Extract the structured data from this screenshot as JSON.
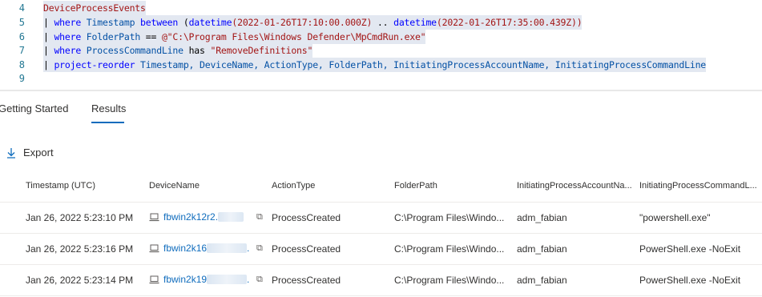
{
  "editor": {
    "lines": [
      {
        "n": "4",
        "parts": [
          {
            "t": "DeviceProcessEvents",
            "c": "kw-table"
          }
        ]
      },
      {
        "n": "5",
        "parts": [
          {
            "t": "| ",
            "c": "op"
          },
          {
            "t": "where",
            "c": "kw"
          },
          {
            "t": " Timestamp ",
            "c": "fld"
          },
          {
            "t": "between",
            "c": "kw"
          },
          {
            "t": " (",
            "c": "op"
          },
          {
            "t": "datetime",
            "c": "kw"
          },
          {
            "t": "(2022-01-26T17:10:00.000Z)",
            "c": "str"
          },
          {
            "t": " .. ",
            "c": "op"
          },
          {
            "t": "datetime",
            "c": "kw"
          },
          {
            "t": "(2022-01-26T17:35:00.439Z))",
            "c": "str"
          }
        ]
      },
      {
        "n": "6",
        "parts": [
          {
            "t": "| ",
            "c": "op"
          },
          {
            "t": "where",
            "c": "kw"
          },
          {
            "t": " FolderPath ",
            "c": "fld"
          },
          {
            "t": "== ",
            "c": "op"
          },
          {
            "t": "@\"C:\\Program Files\\Windows Defender\\MpCmdRun.exe\"",
            "c": "str"
          }
        ]
      },
      {
        "n": "7",
        "parts": [
          {
            "t": "| ",
            "c": "op"
          },
          {
            "t": "where",
            "c": "kw"
          },
          {
            "t": " ProcessCommandLine ",
            "c": "fld"
          },
          {
            "t": "has ",
            "c": "op"
          },
          {
            "t": "\"RemoveDefinitions\"",
            "c": "str"
          }
        ]
      },
      {
        "n": "8",
        "parts": [
          {
            "t": "| ",
            "c": "op"
          },
          {
            "t": "project-reorder",
            "c": "kw"
          },
          {
            "t": " Timestamp, DeviceName, ActionType, FolderPath, InitiatingProcessAccountName, InitiatingProcessCommandLine",
            "c": "fld"
          }
        ]
      },
      {
        "n": "9",
        "parts": []
      }
    ]
  },
  "tabs": [
    {
      "label": "Getting Started",
      "active": false
    },
    {
      "label": "Results",
      "active": true
    }
  ],
  "toolbar": {
    "export_label": "Export"
  },
  "table": {
    "columns": [
      "Timestamp (UTC)",
      "DeviceName",
      "ActionType",
      "FolderPath",
      "InitiatingProcessAccountNa...",
      "InitiatingProcessCommandL..."
    ],
    "rows": [
      {
        "timestamp": "Jan 26, 2022 5:23:10 PM",
        "device": "fbwin2k12r2.",
        "device_suffix": "",
        "action": "ProcessCreated",
        "folder": "C:\\Program Files\\Windo...",
        "account": "adm_fabian",
        "cmd": "\"powershell.exe\""
      },
      {
        "timestamp": "Jan 26, 2022 5:23:16 PM",
        "device": "fbwin2k16",
        "device_suffix": ".",
        "action": "ProcessCreated",
        "folder": "C:\\Program Files\\Windo...",
        "account": "adm_fabian",
        "cmd": "PowerShell.exe -NoExit"
      },
      {
        "timestamp": "Jan 26, 2022 5:23:14 PM",
        "device": "fbwin2k19",
        "device_suffix": ".",
        "action": "ProcessCreated",
        "folder": "C:\\Program Files\\Windo...",
        "account": "adm_fabian",
        "cmd": "PowerShell.exe -NoExit"
      }
    ]
  },
  "colors": {
    "accent": "#0f6cbd",
    "selection": "#e3e8f1",
    "line_number": "#237893"
  }
}
